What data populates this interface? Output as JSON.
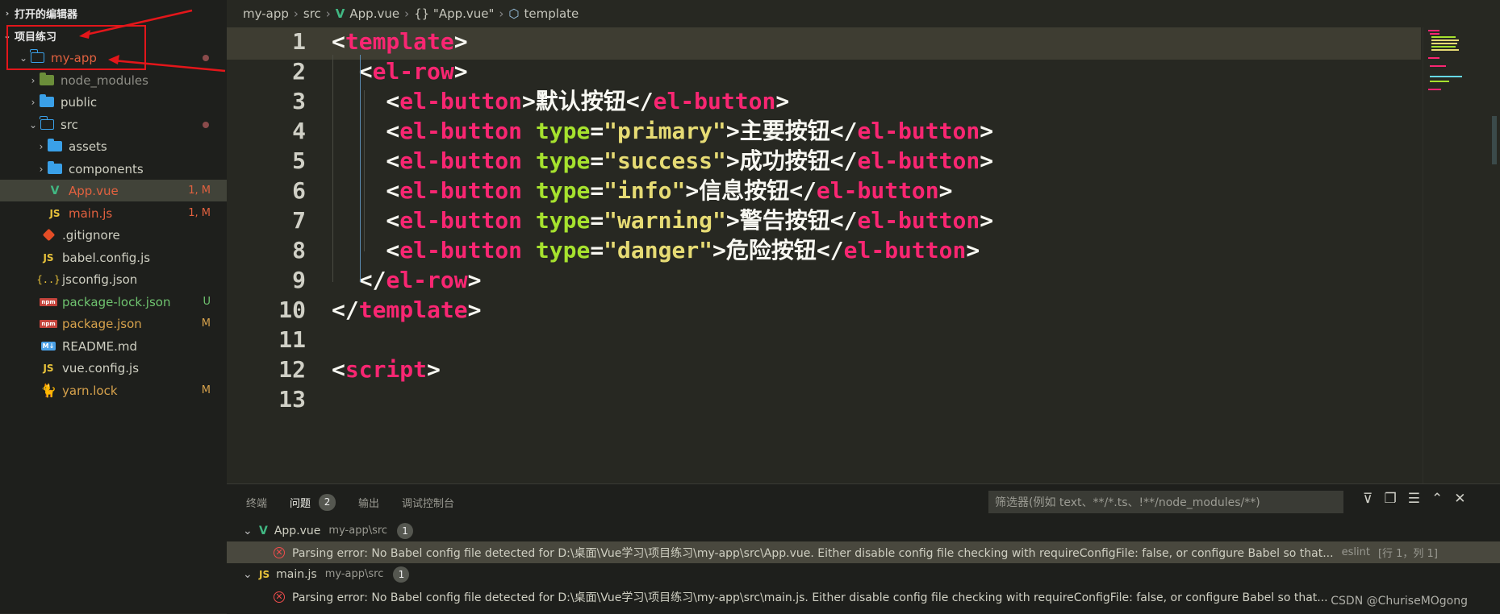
{
  "sidebar": {
    "open_editors": "打开的编辑器",
    "project": "项目练习",
    "items": [
      {
        "label": "my-app",
        "badge": "",
        "dot": true
      },
      {
        "label": "node_modules",
        "badge": ""
      },
      {
        "label": "public",
        "badge": ""
      },
      {
        "label": "src",
        "badge": "",
        "dot": true
      },
      {
        "label": "assets",
        "badge": ""
      },
      {
        "label": "components",
        "badge": ""
      },
      {
        "label": "App.vue",
        "badge": "1, M"
      },
      {
        "label": "main.js",
        "badge": "1, M"
      },
      {
        "label": ".gitignore",
        "badge": ""
      },
      {
        "label": "babel.config.js",
        "badge": ""
      },
      {
        "label": "jsconfig.json",
        "badge": ""
      },
      {
        "label": "package-lock.json",
        "badge": "U"
      },
      {
        "label": "package.json",
        "badge": "M"
      },
      {
        "label": "README.md",
        "badge": ""
      },
      {
        "label": "vue.config.js",
        "badge": ""
      },
      {
        "label": "yarn.lock",
        "badge": "M"
      }
    ],
    "icons": {
      "js": "JS",
      "json": "{..}",
      "npm": "npm",
      "md": "M↓"
    }
  },
  "breadcrumb": {
    "items": [
      "my-app",
      "src",
      "App.vue",
      "{} \"App.vue\"",
      "template"
    ]
  },
  "editor": {
    "lines": [
      {
        "n": "1",
        "t": [
          [
            "p",
            "<"
          ],
          [
            "t",
            "template"
          ],
          [
            "p",
            ">"
          ]
        ]
      },
      {
        "n": "2",
        "t": [
          [
            "p",
            "  <"
          ],
          [
            "t",
            "el-row"
          ],
          [
            "p",
            ">"
          ]
        ]
      },
      {
        "n": "3",
        "t": [
          [
            "p",
            "    <"
          ],
          [
            "t",
            "el-button"
          ],
          [
            "p",
            ">"
          ],
          [
            "x",
            "默认按钮"
          ],
          [
            "p",
            "</"
          ],
          [
            "t",
            "el-button"
          ],
          [
            "p",
            ">"
          ]
        ]
      },
      {
        "n": "4",
        "t": [
          [
            "p",
            "    <"
          ],
          [
            "t",
            "el-button"
          ],
          [
            "p",
            " "
          ],
          [
            "a",
            "type"
          ],
          [
            "p",
            "="
          ],
          [
            "s",
            "\"primary\""
          ],
          [
            "p",
            ">"
          ],
          [
            "x",
            "主要按钮"
          ],
          [
            "p",
            "</"
          ],
          [
            "t",
            "el-button"
          ],
          [
            "p",
            ">"
          ]
        ]
      },
      {
        "n": "5",
        "t": [
          [
            "p",
            "    <"
          ],
          [
            "t",
            "el-button"
          ],
          [
            "p",
            " "
          ],
          [
            "a",
            "type"
          ],
          [
            "p",
            "="
          ],
          [
            "s",
            "\"success\""
          ],
          [
            "p",
            ">"
          ],
          [
            "x",
            "成功按钮"
          ],
          [
            "p",
            "</"
          ],
          [
            "t",
            "el-button"
          ],
          [
            "p",
            ">"
          ]
        ]
      },
      {
        "n": "6",
        "t": [
          [
            "p",
            "    <"
          ],
          [
            "t",
            "el-button"
          ],
          [
            "p",
            " "
          ],
          [
            "a",
            "type"
          ],
          [
            "p",
            "="
          ],
          [
            "s",
            "\"info\""
          ],
          [
            "p",
            ">"
          ],
          [
            "x",
            "信息按钮"
          ],
          [
            "p",
            "</"
          ],
          [
            "t",
            "el-button"
          ],
          [
            "p",
            ">"
          ]
        ]
      },
      {
        "n": "7",
        "t": [
          [
            "p",
            "    <"
          ],
          [
            "t",
            "el-button"
          ],
          [
            "p",
            " "
          ],
          [
            "a",
            "type"
          ],
          [
            "p",
            "="
          ],
          [
            "s",
            "\"warning\""
          ],
          [
            "p",
            ">"
          ],
          [
            "x",
            "警告按钮"
          ],
          [
            "p",
            "</"
          ],
          [
            "t",
            "el-button"
          ],
          [
            "p",
            ">"
          ]
        ]
      },
      {
        "n": "8",
        "t": [
          [
            "p",
            "    <"
          ],
          [
            "t",
            "el-button"
          ],
          [
            "p",
            " "
          ],
          [
            "a",
            "type"
          ],
          [
            "p",
            "="
          ],
          [
            "s",
            "\"danger\""
          ],
          [
            "p",
            ">"
          ],
          [
            "x",
            "危险按钮"
          ],
          [
            "p",
            "</"
          ],
          [
            "t",
            "el-button"
          ],
          [
            "p",
            ">"
          ]
        ]
      },
      {
        "n": "9",
        "t": [
          [
            "p",
            "  </"
          ],
          [
            "t",
            "el-row"
          ],
          [
            "p",
            ">"
          ]
        ]
      },
      {
        "n": "10",
        "t": [
          [
            "p",
            "</"
          ],
          [
            "t",
            "template"
          ],
          [
            "p",
            ">"
          ]
        ]
      },
      {
        "n": "11",
        "t": []
      },
      {
        "n": "12",
        "t": [
          [
            "p",
            "<"
          ],
          [
            "t",
            "script"
          ],
          [
            "p",
            ">"
          ]
        ]
      },
      {
        "n": "13",
        "t": []
      }
    ]
  },
  "panel": {
    "tabs": [
      "终端",
      "问题",
      "输出",
      "调试控制台"
    ],
    "problem_count": "2",
    "filter_placeholder": "筛选器(例如 text、**/*.ts、!**/node_modules/**)",
    "groups": [
      {
        "file": "App.vue",
        "path": "my-app\\src",
        "count": "1",
        "message": "Parsing error: No Babel config file detected for D:\\桌面\\Vue学习\\项目练习\\my-app\\src\\App.vue. Either disable config file checking with requireConfigFile: false, or configure Babel so that...",
        "source": "eslint",
        "location": "[行 1，列 1]"
      },
      {
        "file": "main.js",
        "path": "my-app\\src",
        "count": "1",
        "message": "Parsing error: No Babel config file detected for D:\\桌面\\Vue学习\\项目练习\\my-app\\src\\main.js. Either disable config file checking with requireConfigFile: false, or configure Babel so that...",
        "source": "",
        "location": ""
      }
    ]
  },
  "watermark": "CSDN @ChuriseMOgong",
  "colors": {
    "tag": "#f92672",
    "attr": "#a6e22e",
    "string": "#e6db74",
    "annotation": "#e3161a"
  }
}
